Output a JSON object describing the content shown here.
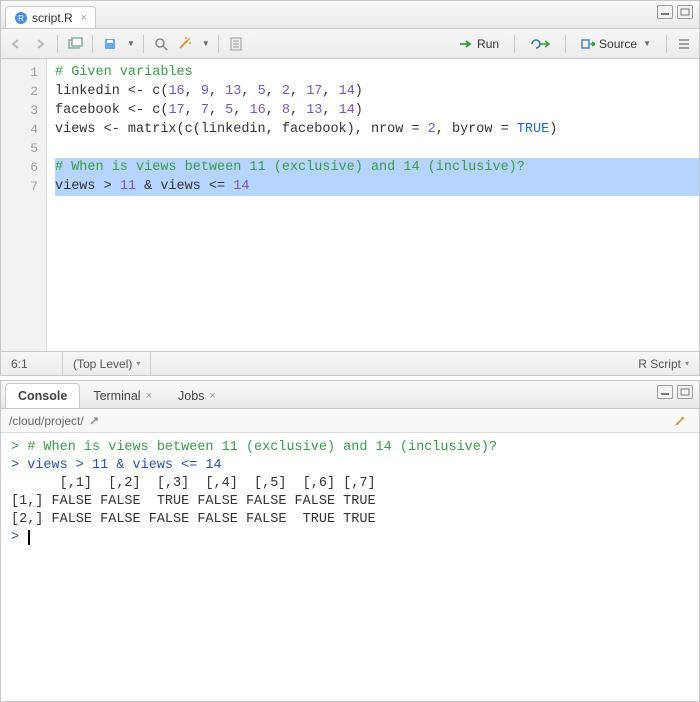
{
  "source": {
    "tab_file": "script.R",
    "toolbar": {
      "run_label": "Run",
      "source_label": "Source"
    },
    "gutter": [
      "1",
      "2",
      "3",
      "4",
      "5",
      "6",
      "7"
    ],
    "code_tokens": [
      [
        {
          "t": "# Given variables",
          "c": "c-comment"
        }
      ],
      [
        {
          "t": "linkedin ",
          "c": "c-sym"
        },
        {
          "t": "<-",
          "c": "c-sym"
        },
        {
          "t": " c(",
          "c": "c-sym"
        },
        {
          "t": "16",
          "c": "c-num"
        },
        {
          "t": ", ",
          "c": "c-sym"
        },
        {
          "t": "9",
          "c": "c-num"
        },
        {
          "t": ", ",
          "c": "c-sym"
        },
        {
          "t": "13",
          "c": "c-num"
        },
        {
          "t": ", ",
          "c": "c-sym"
        },
        {
          "t": "5",
          "c": "c-num"
        },
        {
          "t": ", ",
          "c": "c-sym"
        },
        {
          "t": "2",
          "c": "c-num"
        },
        {
          "t": ", ",
          "c": "c-sym"
        },
        {
          "t": "17",
          "c": "c-num"
        },
        {
          "t": ", ",
          "c": "c-sym"
        },
        {
          "t": "14",
          "c": "c-num"
        },
        {
          "t": ")",
          "c": "c-sym"
        }
      ],
      [
        {
          "t": "facebook ",
          "c": "c-sym"
        },
        {
          "t": "<-",
          "c": "c-sym"
        },
        {
          "t": " c(",
          "c": "c-sym"
        },
        {
          "t": "17",
          "c": "c-num"
        },
        {
          "t": ", ",
          "c": "c-sym"
        },
        {
          "t": "7",
          "c": "c-num"
        },
        {
          "t": ", ",
          "c": "c-sym"
        },
        {
          "t": "5",
          "c": "c-num"
        },
        {
          "t": ", ",
          "c": "c-sym"
        },
        {
          "t": "16",
          "c": "c-num"
        },
        {
          "t": ", ",
          "c": "c-sym"
        },
        {
          "t": "8",
          "c": "c-num"
        },
        {
          "t": ", ",
          "c": "c-sym"
        },
        {
          "t": "13",
          "c": "c-num"
        },
        {
          "t": ", ",
          "c": "c-sym"
        },
        {
          "t": "14",
          "c": "c-num"
        },
        {
          "t": ")",
          "c": "c-sym"
        }
      ],
      [
        {
          "t": "views ",
          "c": "c-sym"
        },
        {
          "t": "<-",
          "c": "c-sym"
        },
        {
          "t": " matrix(c(linkedin, facebook), nrow = ",
          "c": "c-sym"
        },
        {
          "t": "2",
          "c": "c-num"
        },
        {
          "t": ", byrow = ",
          "c": "c-sym"
        },
        {
          "t": "TRUE",
          "c": "c-const"
        },
        {
          "t": ")",
          "c": "c-sym"
        }
      ],
      [
        {
          "t": "",
          "c": "c-sym"
        }
      ],
      [
        {
          "t": "# When is views between 11 (exclusive) and 14 (inclusive)?",
          "c": "c-comment"
        }
      ],
      [
        {
          "t": "views > ",
          "c": "c-sym"
        },
        {
          "t": "11",
          "c": "c-num"
        },
        {
          "t": " & views <= ",
          "c": "c-sym"
        },
        {
          "t": "14",
          "c": "c-num"
        }
      ]
    ],
    "selected_lines": [
      6,
      7
    ],
    "status_pos": "6:1",
    "status_scope": "(Top Level)",
    "status_lang": "R Script"
  },
  "console": {
    "tabs": {
      "console": "Console",
      "terminal": "Terminal",
      "jobs": "Jobs"
    },
    "path": "/cloud/project/",
    "lines": [
      {
        "text": "> # When is views between 11 (exclusive) and 14 (inclusive)?",
        "cls": "cons-comment"
      },
      {
        "text": "> views > 11 & views <= 14",
        "cls": "cons-in"
      },
      {
        "text": "      [,1]  [,2]  [,3]  [,4]  [,5]  [,6] [,7]",
        "cls": "cons-out"
      },
      {
        "text": "[1,] FALSE FALSE  TRUE FALSE FALSE FALSE TRUE",
        "cls": "cons-out"
      },
      {
        "text": "[2,] FALSE FALSE FALSE FALSE FALSE  TRUE TRUE",
        "cls": "cons-out"
      }
    ],
    "prompt": "> "
  }
}
